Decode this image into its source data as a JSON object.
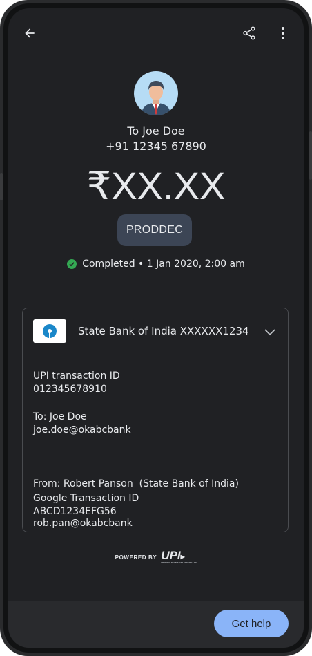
{
  "header": {
    "back_icon": "arrow-back-icon",
    "share_icon": "share-icon",
    "more_icon": "more-vert-icon"
  },
  "recipient": {
    "avatar_icon": "person-avatar-icon",
    "name_line": "To Joe Doe",
    "phone": "+91 12345 67890"
  },
  "amount": "₹XX.XX",
  "note_chip": "PRODDEC",
  "status": {
    "icon": "check-circle-icon",
    "color": "#34a853",
    "text": "Completed • 1 Jan 2020, 2:00 am"
  },
  "card": {
    "bank_logo_icon": "sbi-logo-icon",
    "bank_account": "State Bank of India XXXXXX1234",
    "expand_icon": "chevron-down-icon",
    "fields": [
      {
        "label": "UPI transaction ID",
        "value": "012345678910"
      },
      {
        "label": "To: Joe Doe",
        "value": "joe.doe@okabcbank"
      },
      {
        "label": "From: Robert Panson  (State Bank of India)",
        "value": "rob.pan@okabcbank"
      },
      {
        "label": "Google Transaction ID",
        "value": "ABCD1234EFG56"
      }
    ]
  },
  "footer": {
    "powered_by": "POWERED BY",
    "upi_logo_icon": "upi-logo-icon",
    "upi_text": "UPI",
    "upi_tagline": "UNIFIED PAYMENTS INTERFACE"
  },
  "bottom": {
    "help_label": "Get help",
    "accent": "#8ab4f8"
  }
}
